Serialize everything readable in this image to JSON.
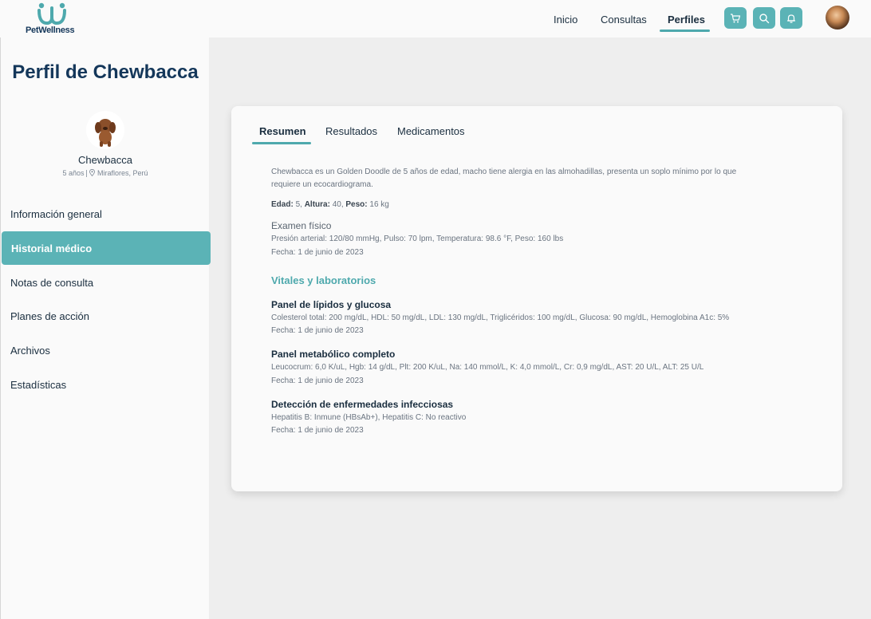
{
  "brand": {
    "name": "PetWellness",
    "colors": {
      "primary": "#5bb3b6",
      "dark": "#14375a"
    }
  },
  "nav": {
    "links": [
      "Inicio",
      "Consultas",
      "Perfiles"
    ],
    "active": "Perfiles",
    "icons": [
      "cart-icon",
      "search-icon",
      "bell-icon"
    ]
  },
  "sidebar": {
    "title": "Perfil de Chewbacca",
    "pet_name": "Chewbacca",
    "age": "5 años",
    "location": "Miraflores, Perú",
    "menu": [
      {
        "label": "Información general"
      },
      {
        "label": "Historial médico"
      },
      {
        "label": "Notas de consulta"
      },
      {
        "label": "Planes de acción"
      },
      {
        "label": "Archivos"
      },
      {
        "label": "Estadísticas"
      }
    ],
    "active_item": "Historial médico"
  },
  "tabs": [
    {
      "label": "Resumen"
    },
    {
      "label": "Resultados"
    },
    {
      "label": "Medicamentos"
    }
  ],
  "active_tab": "Resumen",
  "summary": {
    "description_line1": "Chewbacca es un Golden Doodle de 5 años de edad, macho tiene alergia en las almohadillas, presenta un soplo mínimo por lo que",
    "description_line2": "requiere un ecocardiograma.",
    "age_label": "Edad:",
    "age_value": "5,",
    "height_label": "Altura:",
    "height_value": "40,",
    "weight_label": "Peso:",
    "weight_value": "16 kg",
    "exam_title": "Examen físico",
    "exam_detail": "Presión arterial: 120/80 mmHg, Pulso: 70 lpm, Temperatura: 98.6 °F, Peso: 160 lbs",
    "exam_date": "Fecha: 1 de junio de 2023"
  },
  "vitals": {
    "title": "Vitales y laboratorios",
    "panels": [
      {
        "title": "Panel de lípidos y glucosa",
        "detail": "Colesterol total: 200 mg/dL, HDL: 50 mg/dL, LDL: 130 mg/dL, Triglicéridos: 100 mg/dL, Glucosa: 90 mg/dL, Hemoglobina A1c: 5%",
        "date": "Fecha: 1 de junio de 2023"
      },
      {
        "title": "Panel metabólico completo",
        "detail": "Leucocrum: 6,0 K/uL, Hgb: 14 g/dL, Plt: 200 K/uL, Na: 140 mmol/L, K: 4,0 mmol/L, Cr: 0,9 mg/dL, AST: 20 U/L, ALT: 25 U/L",
        "date": "Fecha: 1 de junio de 2023"
      },
      {
        "title": "Detección de enfermedades infecciosas",
        "detail": "Hepatitis B: Inmune (HBsAb+), Hepatitis C: No reactivo",
        "date": "Fecha: 1 de junio de 2023"
      }
    ]
  }
}
